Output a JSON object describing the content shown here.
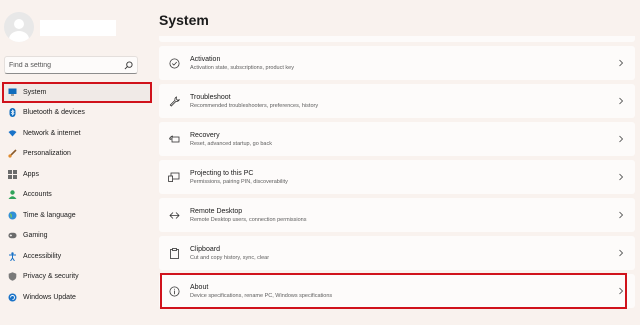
{
  "search": {
    "placeholder": "Find a setting"
  },
  "page_title": "System",
  "nav": [
    {
      "label": "System",
      "icon": "system-monitor-icon",
      "active": true
    },
    {
      "label": "Bluetooth & devices",
      "icon": "bluetooth-icon"
    },
    {
      "label": "Network & internet",
      "icon": "wifi-icon"
    },
    {
      "label": "Personalization",
      "icon": "brush-icon"
    },
    {
      "label": "Apps",
      "icon": "apps-icon"
    },
    {
      "label": "Accounts",
      "icon": "person-icon"
    },
    {
      "label": "Time & language",
      "icon": "globe-icon"
    },
    {
      "label": "Gaming",
      "icon": "gamepad-icon"
    },
    {
      "label": "Accessibility",
      "icon": "accessibility-icon"
    },
    {
      "label": "Privacy & security",
      "icon": "shield-icon"
    },
    {
      "label": "Windows Update",
      "icon": "update-icon"
    }
  ],
  "settings": [
    {
      "title": "Activation",
      "subtitle": "Activation state, subscriptions, product key",
      "icon": "check-circle-icon"
    },
    {
      "title": "Troubleshoot",
      "subtitle": "Recommended troubleshooters, preferences, history",
      "icon": "wrench-icon"
    },
    {
      "title": "Recovery",
      "subtitle": "Reset, advanced startup, go back",
      "icon": "recovery-icon"
    },
    {
      "title": "Projecting to this PC",
      "subtitle": "Permissions, pairing PIN, discoverability",
      "icon": "projector-icon"
    },
    {
      "title": "Remote Desktop",
      "subtitle": "Remote Desktop users, connection permissions",
      "icon": "remote-desktop-icon"
    },
    {
      "title": "Clipboard",
      "subtitle": "Cut and copy history, sync, clear",
      "icon": "clipboard-icon"
    },
    {
      "title": "About",
      "subtitle": "Device specifications, rename PC, Windows specifications",
      "icon": "info-icon",
      "highlighted": true
    }
  ],
  "colors": {
    "highlight": "#d0121b",
    "accent": "#0067c0",
    "background": "#f9f2ee"
  }
}
